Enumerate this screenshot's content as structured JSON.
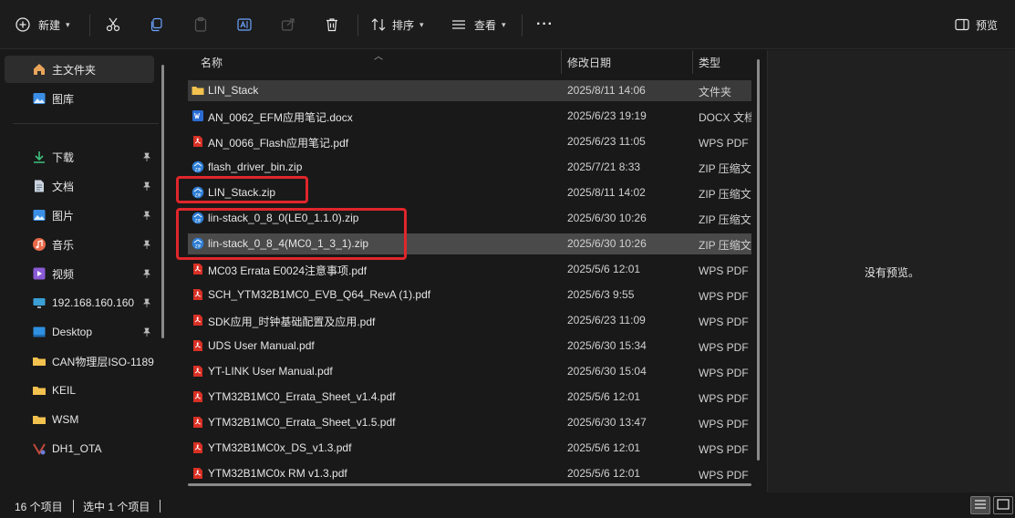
{
  "toolbar": {
    "new_label": "新建",
    "sort_label": "排序",
    "view_label": "查看",
    "more_label": "···",
    "preview_label": "预览"
  },
  "sidebar": {
    "items": [
      {
        "label": "主文件夹",
        "icon": "home-icon"
      },
      {
        "label": "图库",
        "icon": "gallery-icon"
      },
      {
        "label": "下载",
        "icon": "download-icon",
        "pinned": true
      },
      {
        "label": "文档",
        "icon": "document-icon",
        "pinned": true
      },
      {
        "label": "图片",
        "icon": "pictures-icon",
        "pinned": true
      },
      {
        "label": "音乐",
        "icon": "music-icon",
        "pinned": true
      },
      {
        "label": "视频",
        "icon": "video-icon",
        "pinned": true
      },
      {
        "label": "192.168.160.160",
        "icon": "network-drive-icon",
        "pinned": true
      },
      {
        "label": "Desktop",
        "icon": "desktop-icon",
        "pinned": true
      },
      {
        "label": "CAN物理层ISO-1189",
        "icon": "folder-icon"
      },
      {
        "label": "KEIL",
        "icon": "folder-icon"
      },
      {
        "label": "WSM",
        "icon": "folder-icon"
      },
      {
        "label": "DH1_OTA",
        "icon": "git-folder-icon"
      }
    ]
  },
  "columns": {
    "name": "名称",
    "date": "修改日期",
    "type": "类型"
  },
  "files": [
    {
      "name": "LIN_Stack",
      "date": "2025/8/11 14:06",
      "type": "文件夹",
      "kind": "folder"
    },
    {
      "name": "AN_0062_EFM应用笔记.docx",
      "date": "2025/6/23 19:19",
      "type": "DOCX 文档",
      "kind": "docx"
    },
    {
      "name": "AN_0066_Flash应用笔记.pdf",
      "date": "2025/6/23 11:05",
      "type": "WPS PDF 文档",
      "kind": "pdf"
    },
    {
      "name": "flash_driver_bin.zip",
      "date": "2025/7/21 8:33",
      "type": "ZIP 压缩文件",
      "kind": "zip"
    },
    {
      "name": "LIN_Stack.zip",
      "date": "2025/8/11 14:02",
      "type": "ZIP 压缩文件",
      "kind": "zip"
    },
    {
      "name": "lin-stack_0_8_0(LE0_1.1.0).zip",
      "date": "2025/6/30 10:26",
      "type": "ZIP 压缩文件",
      "kind": "zip"
    },
    {
      "name": "lin-stack_0_8_4(MC0_1_3_1).zip",
      "date": "2025/6/30 10:26",
      "type": "ZIP 压缩文件",
      "kind": "zip"
    },
    {
      "name": "MC03 Errata E0024注意事项.pdf",
      "date": "2025/5/6 12:01",
      "type": "WPS PDF 文档",
      "kind": "pdf"
    },
    {
      "name": "SCH_YTM32B1MC0_EVB_Q64_RevA (1).pdf",
      "date": "2025/6/3 9:55",
      "type": "WPS PDF 文档",
      "kind": "pdf"
    },
    {
      "name": "SDK应用_时钟基础配置及应用.pdf",
      "date": "2025/6/23 11:09",
      "type": "WPS PDF 文档",
      "kind": "pdf"
    },
    {
      "name": "UDS User Manual.pdf",
      "date": "2025/6/30 15:34",
      "type": "WPS PDF 文档",
      "kind": "pdf"
    },
    {
      "name": "YT-LINK User Manual.pdf",
      "date": "2025/6/30 15:04",
      "type": "WPS PDF 文档",
      "kind": "pdf"
    },
    {
      "name": "YTM32B1MC0_Errata_Sheet_v1.4.pdf",
      "date": "2025/5/6 12:01",
      "type": "WPS PDF 文档",
      "kind": "pdf"
    },
    {
      "name": "YTM32B1MC0_Errata_Sheet_v1.5.pdf",
      "date": "2025/6/30 13:47",
      "type": "WPS PDF 文档",
      "kind": "pdf"
    },
    {
      "name": "YTM32B1MC0x_DS_v1.3.pdf",
      "date": "2025/5/6 12:01",
      "type": "WPS PDF 文档",
      "kind": "pdf"
    },
    {
      "name": "YTM32B1MC0x RM v1.3.pdf",
      "date": "2025/5/6 12:01",
      "type": "WPS PDF 文档",
      "kind": "pdf"
    }
  ],
  "preview": {
    "empty_text": "没有预览。"
  },
  "status": {
    "item_count": "16 个项目",
    "selection": "选中 1 个项目"
  },
  "colors": {
    "annotation_red": "#e0262b",
    "selected_row": "#4a4a4a",
    "folder_yellow": "#f2c14e",
    "pdf_red": "#d93025",
    "zip_blue": "#2f7fd6",
    "word_blue": "#2b6cd4"
  }
}
